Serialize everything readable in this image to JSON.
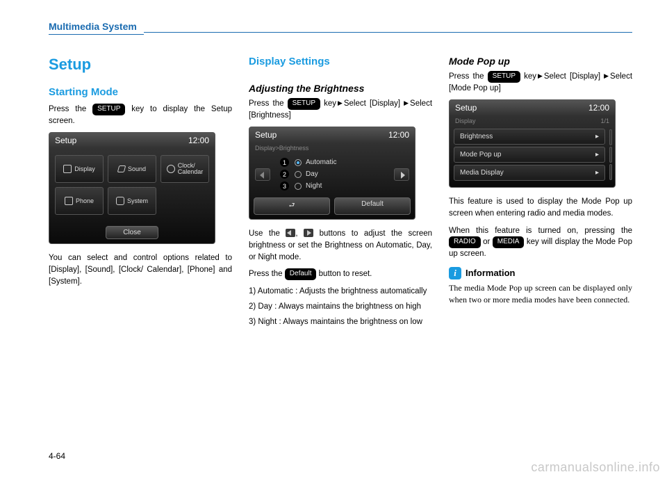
{
  "header": {
    "section": "Multimedia System"
  },
  "page_number": "4-64",
  "watermark": "carmanualsonline.info",
  "keys": {
    "setup": "SETUP",
    "default": "Default",
    "radio": "RADIO",
    "media": "MEDIA"
  },
  "col1": {
    "title": "Setup",
    "h2": "Starting Mode",
    "p1a": "Press the ",
    "p1b": " key to display the Setup screen.",
    "screen": {
      "title": "Setup",
      "time": "12:00",
      "btn1": "Display",
      "btn2": "Sound",
      "btn3": "Clock/\nCalendar",
      "btn4": "Phone",
      "btn5": "System",
      "close": "Close"
    },
    "p2": "You can select and control options related to [Display], [Sound], [Clock/ Calendar], [Phone] and [System]."
  },
  "col2": {
    "h2": "Display Settings",
    "h3": "Adjusting the Brightness",
    "p1a": "Press the ",
    "p1b": " key",
    "p1c": "Select [Display] ",
    "p1d": "Select [Brightness]",
    "screen": {
      "title": "Setup",
      "time": "12:00",
      "breadcrumb": "Display>Brightness",
      "opt1": "Automatic",
      "opt2": "Day",
      "opt3": "Night",
      "default": "Default"
    },
    "p2a": "Use the ",
    "p2b": ", ",
    "p2c": " buttons to adjust the screen brightness or set the Brightness on Automatic, Day, or Night mode.",
    "p3a": "Press the ",
    "p3b": " button to reset.",
    "list": {
      "i1": "1) Automatic : Adjusts the brightness automatically",
      "i2": "2) Day : Always maintains the brightness on high",
      "i3": "3) Night : Always maintains the brightness on low"
    }
  },
  "col3": {
    "h3": "Mode Pop up",
    "p1a": "Press the ",
    "p1b": " key",
    "p1c": "Select [Display] ",
    "p1d": "Select [Mode Pop up]",
    "screen": {
      "title": "Setup",
      "time": "12:00",
      "breadcrumb": "Display",
      "page": "1/1",
      "row1": "Brightness",
      "row2": "Mode Pop up",
      "row3": "Media Display"
    },
    "p2": "This feature is used to display the Mode Pop up screen when entering radio and media modes.",
    "p3a": "When this feature is turned on, pressing the ",
    "p3b": " or ",
    "p3c": " key will display the Mode Pop up screen.",
    "info_title": "Information",
    "info_text": "The media Mode Pop up screen can be displayed only when two or more media modes have been connected."
  }
}
